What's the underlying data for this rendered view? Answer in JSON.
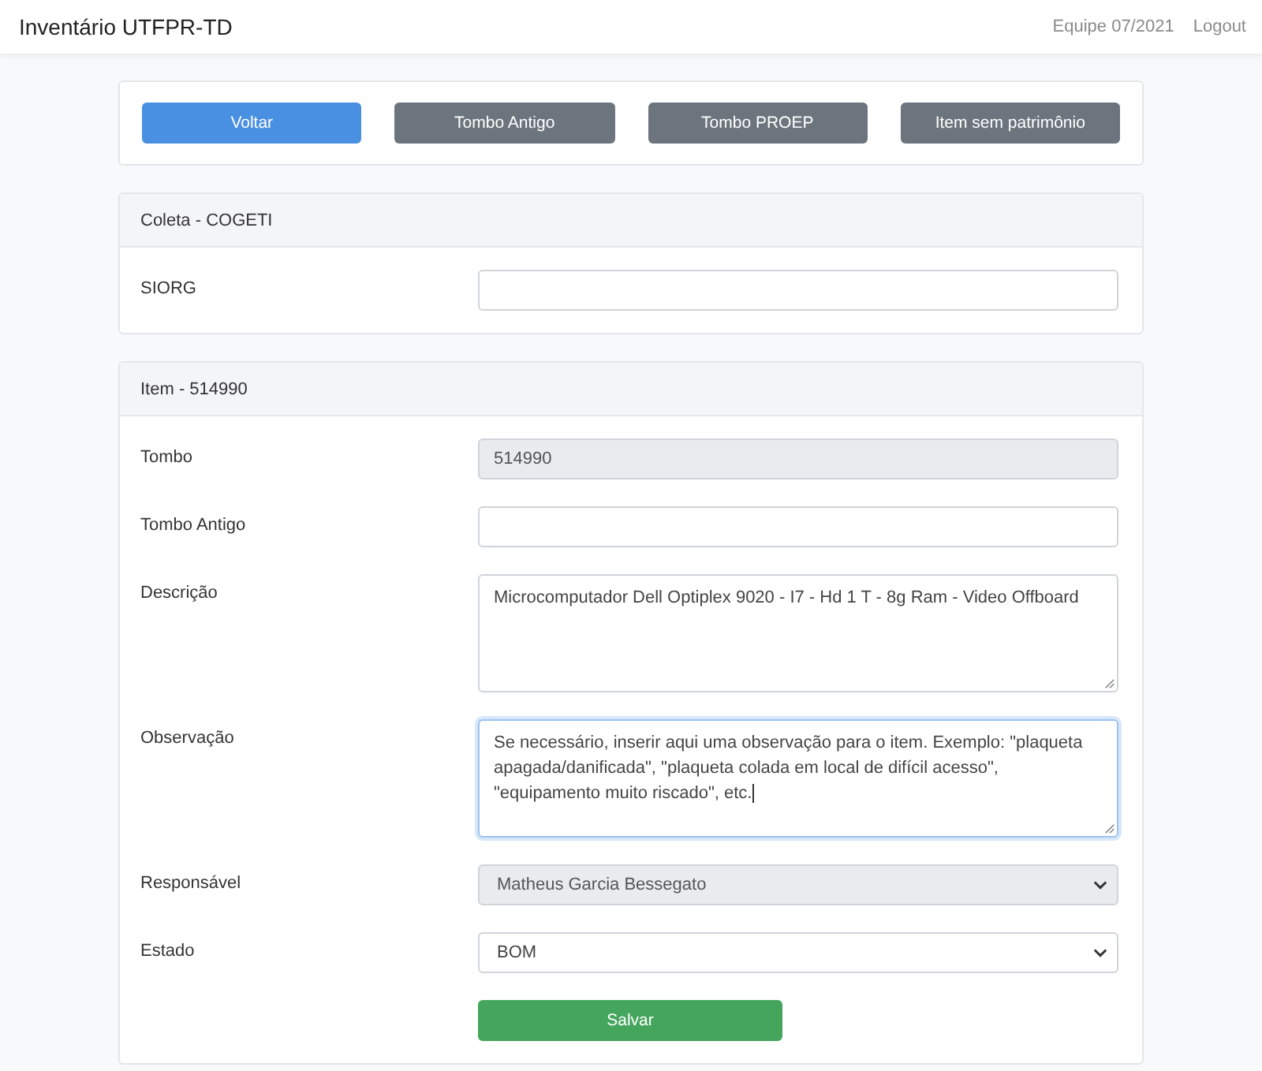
{
  "navbar": {
    "brand": "Inventário UTFPR-TD",
    "links": [
      "Equipe 07/2021",
      "Logout"
    ]
  },
  "actions": [
    {
      "label": "Voltar",
      "kind": "primary"
    },
    {
      "label": "Tombo Antigo",
      "kind": "secondary"
    },
    {
      "label": "Tombo PROEP",
      "kind": "secondary"
    },
    {
      "label": "Item sem patrimônio",
      "kind": "secondary"
    }
  ],
  "cards": [
    {
      "title": "Coleta - COGETI",
      "fields": [
        {
          "label": "SIORG",
          "kind": "input",
          "disabled": false,
          "focused": false
        }
      ]
    },
    {
      "title": "Item - 514990",
      "fields": [
        {
          "label": "Tombo",
          "kind": "input",
          "value": "514990",
          "disabled": true,
          "focused": false
        },
        {
          "label": "Tombo Antigo",
          "kind": "input",
          "disabled": false,
          "focused": false
        },
        {
          "label": "Descrição",
          "kind": "textarea",
          "value": "Microcomputador Dell Optiplex 9020 - I7 - Hd 1 T - 8g Ram - Video Offboard",
          "disabled": false,
          "focused": false
        },
        {
          "label": "Observação",
          "kind": "textarea",
          "value": "Se necessário, inserir aqui uma observação para o item. Exemplo: \"plaqueta apagada/danificada\", \"plaqueta colada em local de difícil acesso\", \"equipamento muito riscado\", etc.",
          "disabled": false,
          "focused": true
        },
        {
          "label": "Responsável",
          "kind": "select",
          "value": "Matheus Garcia Bessegato",
          "disabled": true,
          "focused": false
        },
        {
          "label": "Estado",
          "kind": "select",
          "value": "BOM",
          "disabled": false,
          "focused": false
        }
      ],
      "submit": "Salvar"
    }
  ]
}
